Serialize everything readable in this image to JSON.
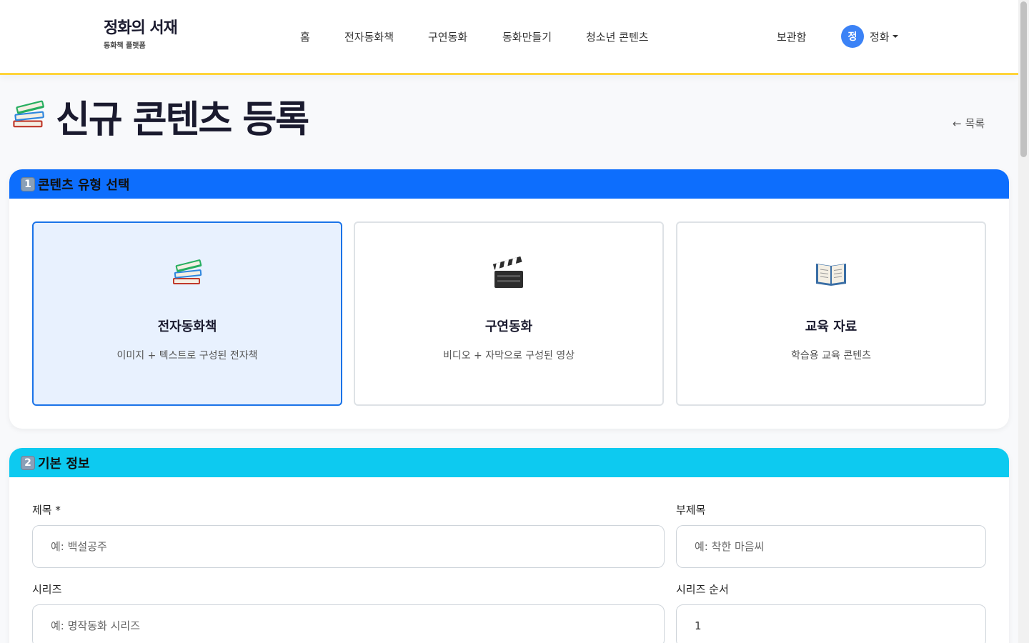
{
  "header": {
    "brand_title": "정화의 서재",
    "brand_subtitle": "동화책 플랫폼",
    "nav": [
      "홈",
      "전자동화책",
      "구연동화",
      "동화만들기",
      "청소년 콘텐츠"
    ],
    "archive_label": "보관함",
    "user_initial": "정",
    "user_name": "정화",
    "accent_color": "#ffd43b"
  },
  "page": {
    "title": "신규 콘텐츠 등록",
    "title_icon": "books-icon",
    "back_label": "목록"
  },
  "section1": {
    "number": "1",
    "title": "콘텐츠 유형 선택",
    "header_color": "#0d6efd",
    "options": [
      {
        "icon": "books-icon",
        "title": "전자동화책",
        "desc": "이미지 + 텍스트로 구성된 전자책",
        "selected": true
      },
      {
        "icon": "clapper-icon",
        "title": "구연동화",
        "desc": "비디오 + 자막으로 구성된 영상",
        "selected": false
      },
      {
        "icon": "open-book-icon",
        "title": "교육 자료",
        "desc": "학습용 교육 콘텐츠",
        "selected": false
      }
    ]
  },
  "section2": {
    "number": "2",
    "title": "기본 정보",
    "header_color": "#0dcaf0",
    "fields": {
      "title": {
        "label": "제목 *",
        "placeholder": "예: 백설공주"
      },
      "subtitle": {
        "label": "부제목",
        "placeholder": "예: 착한 마음씨"
      },
      "series": {
        "label": "시리즈",
        "placeholder": "예: 명작동화 시리즈"
      },
      "series_order": {
        "label": "시리즈 순서",
        "value": "1"
      }
    }
  }
}
